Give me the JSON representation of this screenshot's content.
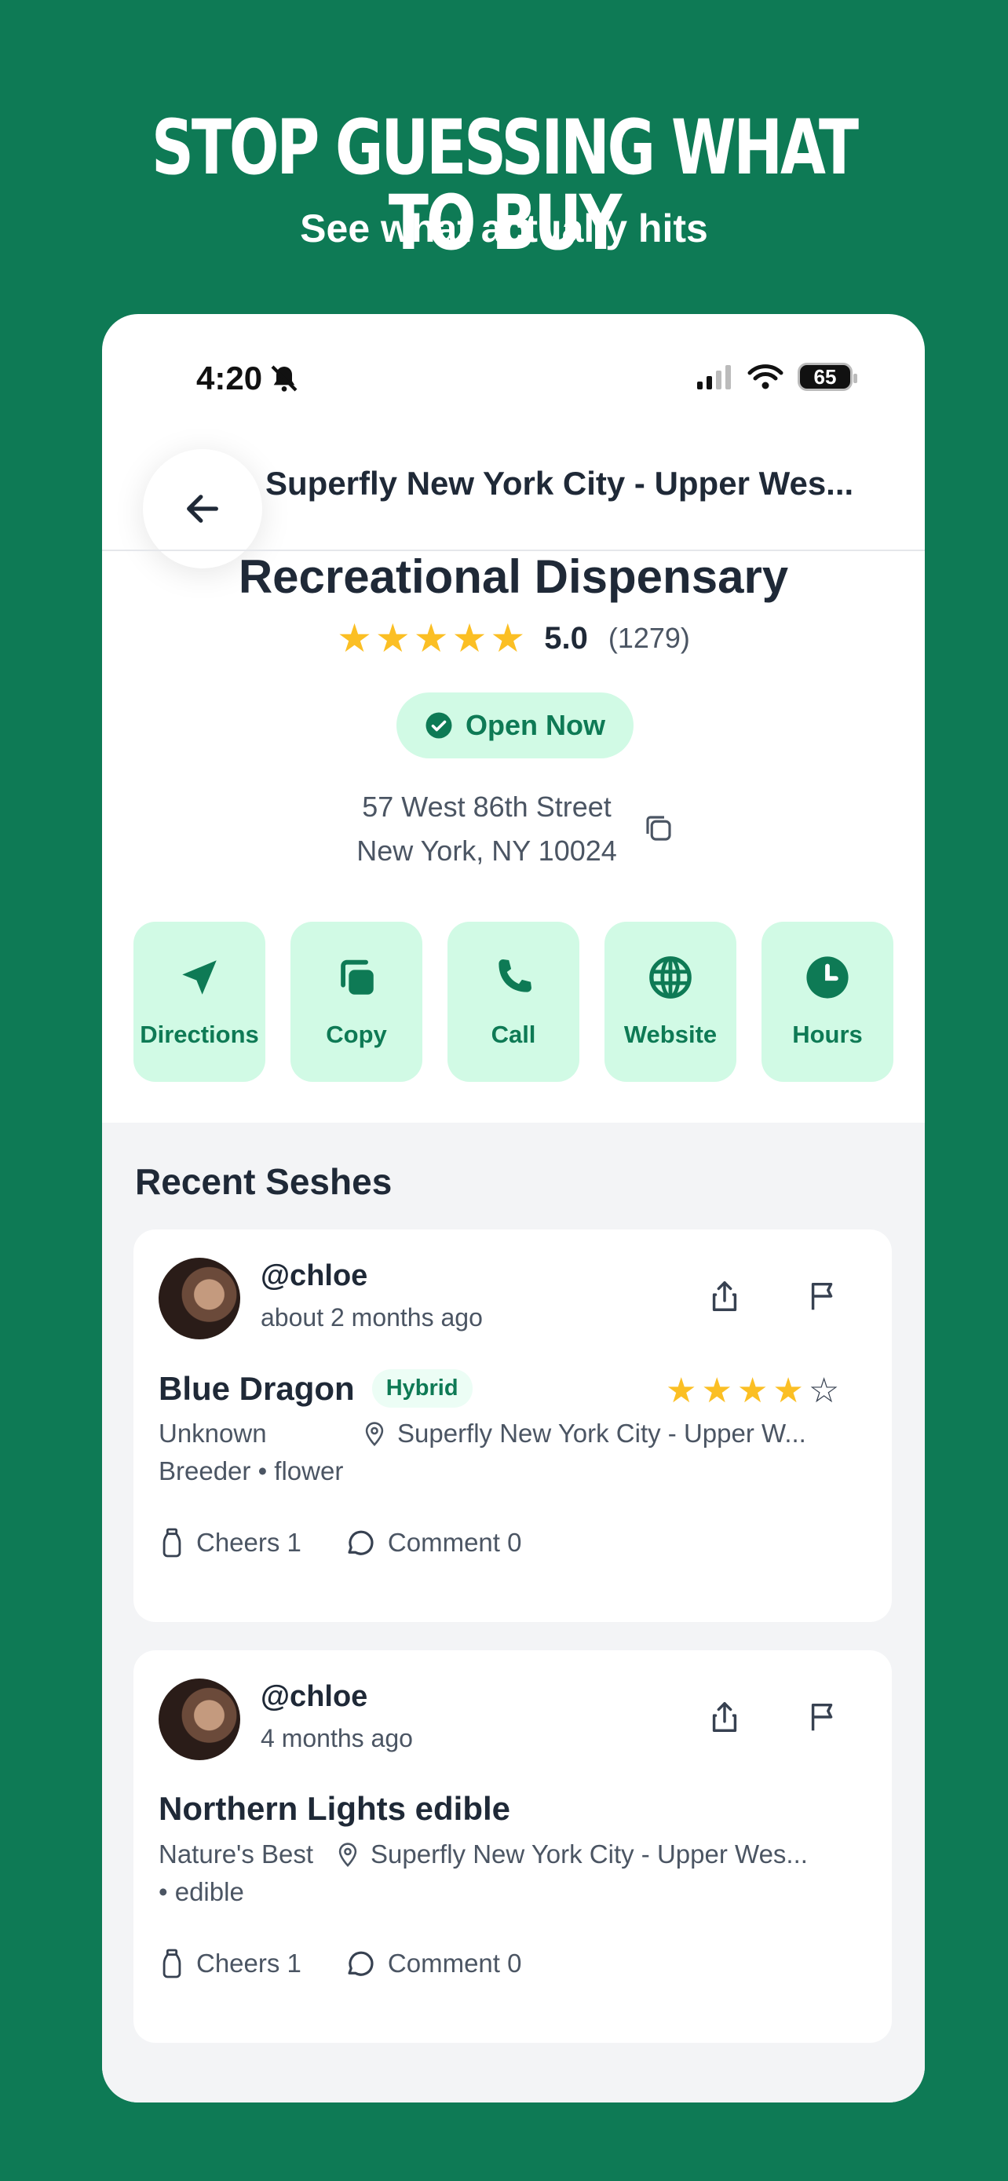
{
  "banner": {
    "headline": "STOP GUESSING WHAT TO BUY",
    "subhead": "See what actually hits"
  },
  "status": {
    "time": "4:20",
    "battery": "65"
  },
  "nav": {
    "title": "Superfly New York City - Upper Wes..."
  },
  "store": {
    "type": "Recreational Dispensary",
    "rating": "5.0",
    "rating_count": "(1279)",
    "stars": 5,
    "open_label": "Open Now",
    "address_line1": "57 West 86th Street",
    "address_line2": "New York, NY 10024"
  },
  "actions": [
    {
      "label": "Directions",
      "icon": "navigation-arrow-icon"
    },
    {
      "label": "Copy",
      "icon": "copy-icon"
    },
    {
      "label": "Call",
      "icon": "phone-icon"
    },
    {
      "label": "Website",
      "icon": "globe-icon"
    },
    {
      "label": "Hours",
      "icon": "clock-icon"
    }
  ],
  "feed": {
    "title": "Recent Seshes",
    "posts": [
      {
        "user": "@chloe",
        "when": "about 2 months ago",
        "strain": "Blue Dragon",
        "badge": "Hybrid",
        "rating": 4,
        "meta_line1": "Unknown",
        "meta_line2": "Breeder • flower",
        "location": "Superfly New York City - Upper W...",
        "cheers": "Cheers 1",
        "comments": "Comment 0"
      },
      {
        "user": "@chloe",
        "when": "4 months ago",
        "strain": "Northern Lights edible",
        "meta_line1": "Nature's Best",
        "meta_line2": "• edible",
        "location": "Superfly New York City - Upper Wes...",
        "cheers": "Cheers 1",
        "comments": "Comment 0"
      }
    ]
  },
  "colors": {
    "brand": "#0e7a55",
    "mint": "#d1fae5",
    "star": "#fbbf24"
  }
}
